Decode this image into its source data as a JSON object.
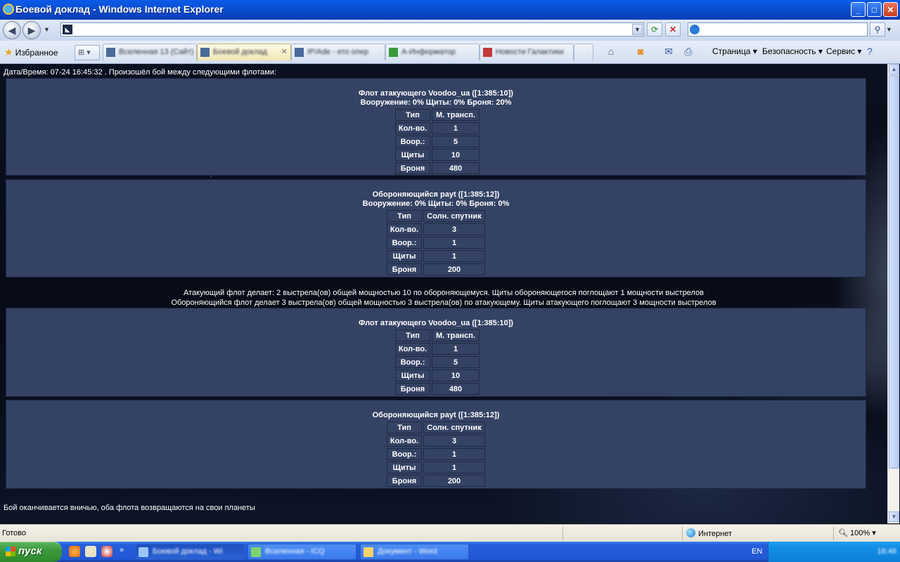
{
  "window": {
    "title": "Боевой доклад - Windows Internet Explorer",
    "minimize": "_",
    "maximize": "□",
    "close": "✕"
  },
  "toolbar": {
    "favorites_label": "Избранное",
    "page_menu": "Страница",
    "security_menu": "Безопасность",
    "tools_menu": "Сервис",
    "back_icon": "back-arrow-icon",
    "forward_icon": "forward-arrow-icon"
  },
  "tabs": [
    {
      "label": "Вселенная 13 (Сайт)",
      "active": false
    },
    {
      "label": "Боевой доклад",
      "active": true
    },
    {
      "label": "IP/Ade - ето опер",
      "active": false
    },
    {
      "label": "А-Информатор",
      "active": false
    },
    {
      "label": "Новости Галактики",
      "active": false
    }
  ],
  "report": {
    "datetime_line": "Дата/Время: 07-24 16:45:32 . Произошёл бой между следующими флотами:",
    "rounds": [
      {
        "attacker": {
          "name": "Флот атакующего Voodoo_ua ([1:385:10])",
          "tech": "Вооружение: 0% Щиты: 0% Броня: 20%",
          "rows": [
            {
              "label": "Тип",
              "value": "М. трансп."
            },
            {
              "label": "Кол-во.",
              "value": "1"
            },
            {
              "label": "Воор.:",
              "value": "5"
            },
            {
              "label": "Щиты",
              "value": "10"
            },
            {
              "label": "Броня",
              "value": "480"
            }
          ]
        },
        "defender": {
          "name": "Обороняющийся payt ([1:385:12])",
          "tech": "Вооружение: 0% Щиты: 0% Броня: 0%",
          "rows": [
            {
              "label": "Тип",
              "value": "Солн. спутник"
            },
            {
              "label": "Кол-во.",
              "value": "3"
            },
            {
              "label": "Воор.:",
              "value": "1"
            },
            {
              "label": "Щиты",
              "value": "1"
            },
            {
              "label": "Броня",
              "value": "200"
            }
          ]
        }
      },
      {
        "attacker": {
          "name": "Флот атакующего Voodoo_ua ([1:385:10])",
          "rows": [
            {
              "label": "Тип",
              "value": "М. трансп."
            },
            {
              "label": "Кол-во.",
              "value": "1"
            },
            {
              "label": "Воор.:",
              "value": "5"
            },
            {
              "label": "Щиты",
              "value": "10"
            },
            {
              "label": "Броня",
              "value": "480"
            }
          ]
        },
        "defender": {
          "name": "Обороняющийся payt ([1:385:12])",
          "rows": [
            {
              "label": "Тип",
              "value": "Солн. спутник"
            },
            {
              "label": "Кол-во.",
              "value": "3"
            },
            {
              "label": "Воор.:",
              "value": "1"
            },
            {
              "label": "Щиты",
              "value": "1"
            },
            {
              "label": "Броня",
              "value": "200"
            }
          ]
        }
      }
    ],
    "round_summary": [
      "Атакующий флот делает: 2 выстрела(ов) общей мощностью 10 по обороняющемуся. Щиты обороняющегося поглощают 1 мощности выстрелов",
      "Обороняющийся флот делает 3 выстрела(ов) общей мощностью 3 выстрела(ов) по атакующему. Щиты атакующего поглощают 3 мощности выстрелов"
    ],
    "result": "Бой оканчивается вничью, оба флота возвращаются на свои планеты"
  },
  "statusbar": {
    "ready": "Готово",
    "zone": "Интернет",
    "zoom": "100%"
  },
  "taskbar": {
    "start": "пуск",
    "language": "EN",
    "tasks": [
      {
        "label": "Боевой доклад - Wi",
        "active": true
      },
      {
        "label": "Вселенная - ICQ",
        "active": false
      },
      {
        "label": "Документ - Word",
        "active": false
      }
    ],
    "clock": "16:46"
  }
}
